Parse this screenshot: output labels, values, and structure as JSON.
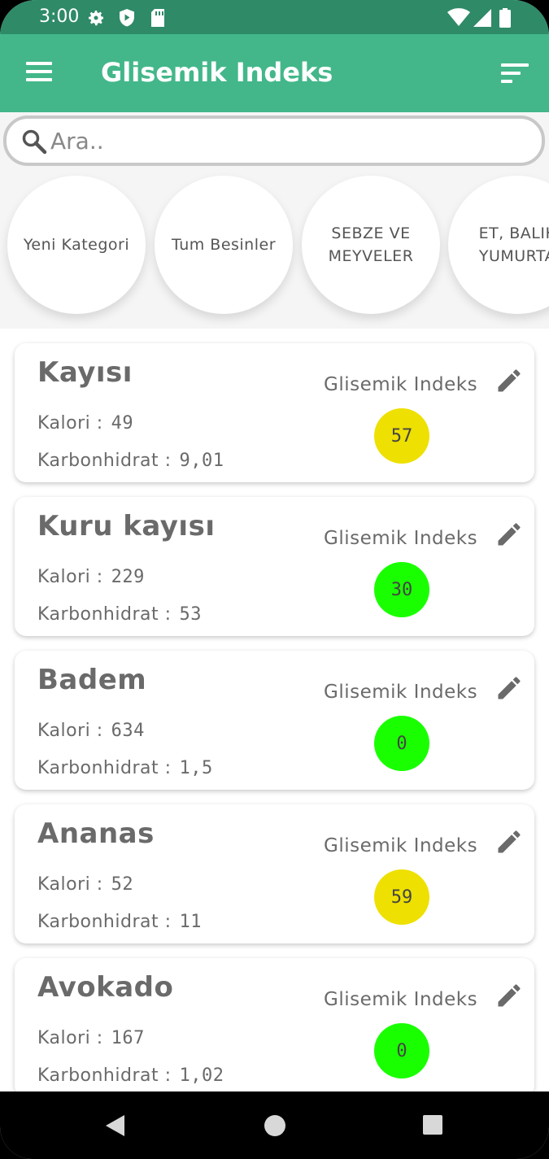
{
  "status_bar": {
    "time": "3:00"
  },
  "app_bar": {
    "title": "Glisemik Indeks"
  },
  "search": {
    "placeholder": "Ara.."
  },
  "categories": [
    {
      "label": "Yeni Kategori"
    },
    {
      "label": "Tum Besinler"
    },
    {
      "label": "SEBZE VE\nMEYVELER"
    },
    {
      "label": "ET, BALIK\nYUMURTA"
    }
  ],
  "labels": {
    "calorie": "Kalori :",
    "carb": "Karbonhidrat :",
    "gi": "Glisemik Indeks"
  },
  "colors": {
    "status_bar": "#2f8a68",
    "app_bar": "#43b78a",
    "gi_high": "#eee000",
    "gi_low": "#19ff00"
  },
  "foods": [
    {
      "name": "Kayısı",
      "calorie": "49",
      "carb": "9,01",
      "gi": "57",
      "gi_color": "#eee000"
    },
    {
      "name": "Kuru kayısı",
      "calorie": "229",
      "carb": "53",
      "gi": "30",
      "gi_color": "#19ff00"
    },
    {
      "name": "Badem",
      "calorie": "634",
      "carb": "1,5",
      "gi": "0",
      "gi_color": "#19ff00"
    },
    {
      "name": "Ananas",
      "calorie": "52",
      "carb": "11",
      "gi": "59",
      "gi_color": "#eee000"
    },
    {
      "name": "Avokado",
      "calorie": "167",
      "carb": "1,02",
      "gi": "0",
      "gi_color": "#19ff00"
    }
  ],
  "icons": {
    "menu": "menu-icon",
    "sort": "sort-icon",
    "search": "search-icon",
    "edit": "pencil-icon",
    "back": "back-triangle-icon",
    "home": "home-circle-icon",
    "recents": "recents-square-icon"
  }
}
